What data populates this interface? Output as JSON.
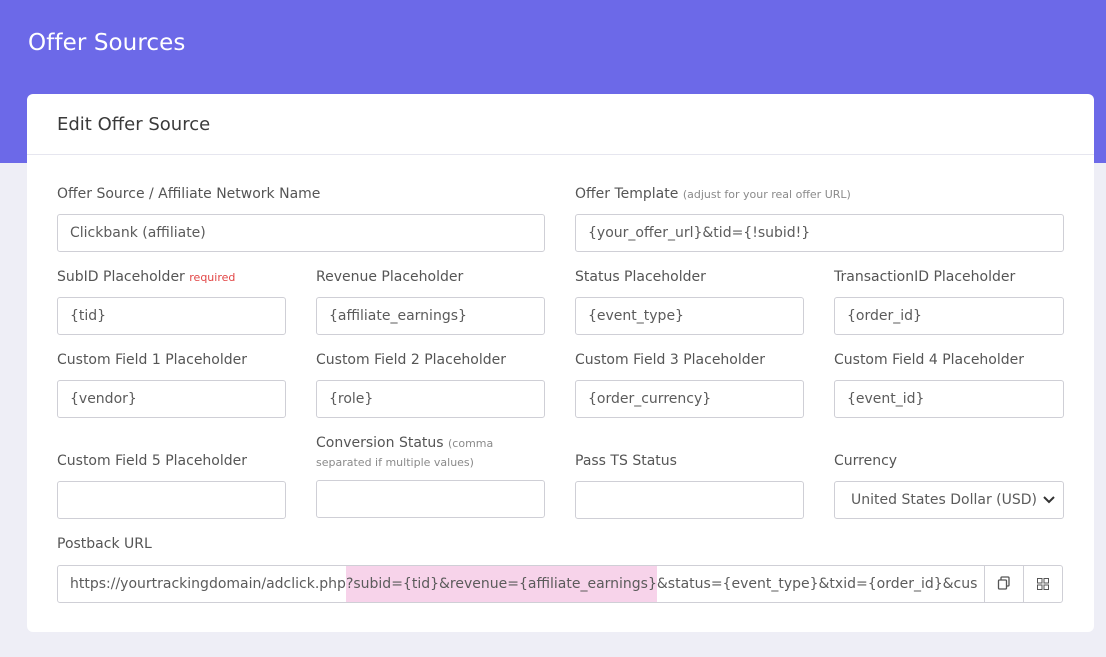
{
  "page": {
    "title": "Offer Sources"
  },
  "card": {
    "title": "Edit Offer Source"
  },
  "fields": {
    "name": {
      "label": "Offer Source / Affiliate Network Name",
      "value": "Clickbank (affiliate)"
    },
    "template": {
      "label": "Offer Template",
      "note": "(adjust for your real offer URL)",
      "value": "{your_offer_url}&tid={!subid!}"
    },
    "subid": {
      "label": "SubID Placeholder",
      "note": "required",
      "value": "{tid}"
    },
    "revenue": {
      "label": "Revenue Placeholder",
      "value": "{affiliate_earnings}"
    },
    "status": {
      "label": "Status Placeholder",
      "value": "{event_type}"
    },
    "txid": {
      "label": "TransactionID Placeholder",
      "value": "{order_id}"
    },
    "cf1": {
      "label": "Custom Field 1 Placeholder",
      "value": "{vendor}"
    },
    "cf2": {
      "label": "Custom Field 2 Placeholder",
      "value": "{role}"
    },
    "cf3": {
      "label": "Custom Field 3 Placeholder",
      "value": "{order_currency}"
    },
    "cf4": {
      "label": "Custom Field 4 Placeholder",
      "value": "{event_id}"
    },
    "cf5": {
      "label": "Custom Field 5 Placeholder",
      "value": ""
    },
    "conv": {
      "label": "Conversion Status",
      "note": "(comma separated if multiple values)",
      "value": ""
    },
    "passts": {
      "label": "Pass TS Status",
      "value": ""
    },
    "currency": {
      "label": "Currency",
      "value": "United States Dollar (USD)"
    }
  },
  "postback": {
    "label": "Postback URL",
    "prefix": "https://yourtrackingdomain/adclick.php",
    "highlight": "?subid={tid}&revenue={affiliate_earnings}",
    "suffix": "&status={event_type}&txid={order_id}&cus",
    "copy_icon": "copy-icon",
    "qr_icon": "grid-icon"
  },
  "colors": {
    "header": "#6c69e8",
    "highlight": "#f7d3ea",
    "required": "#e24545"
  }
}
